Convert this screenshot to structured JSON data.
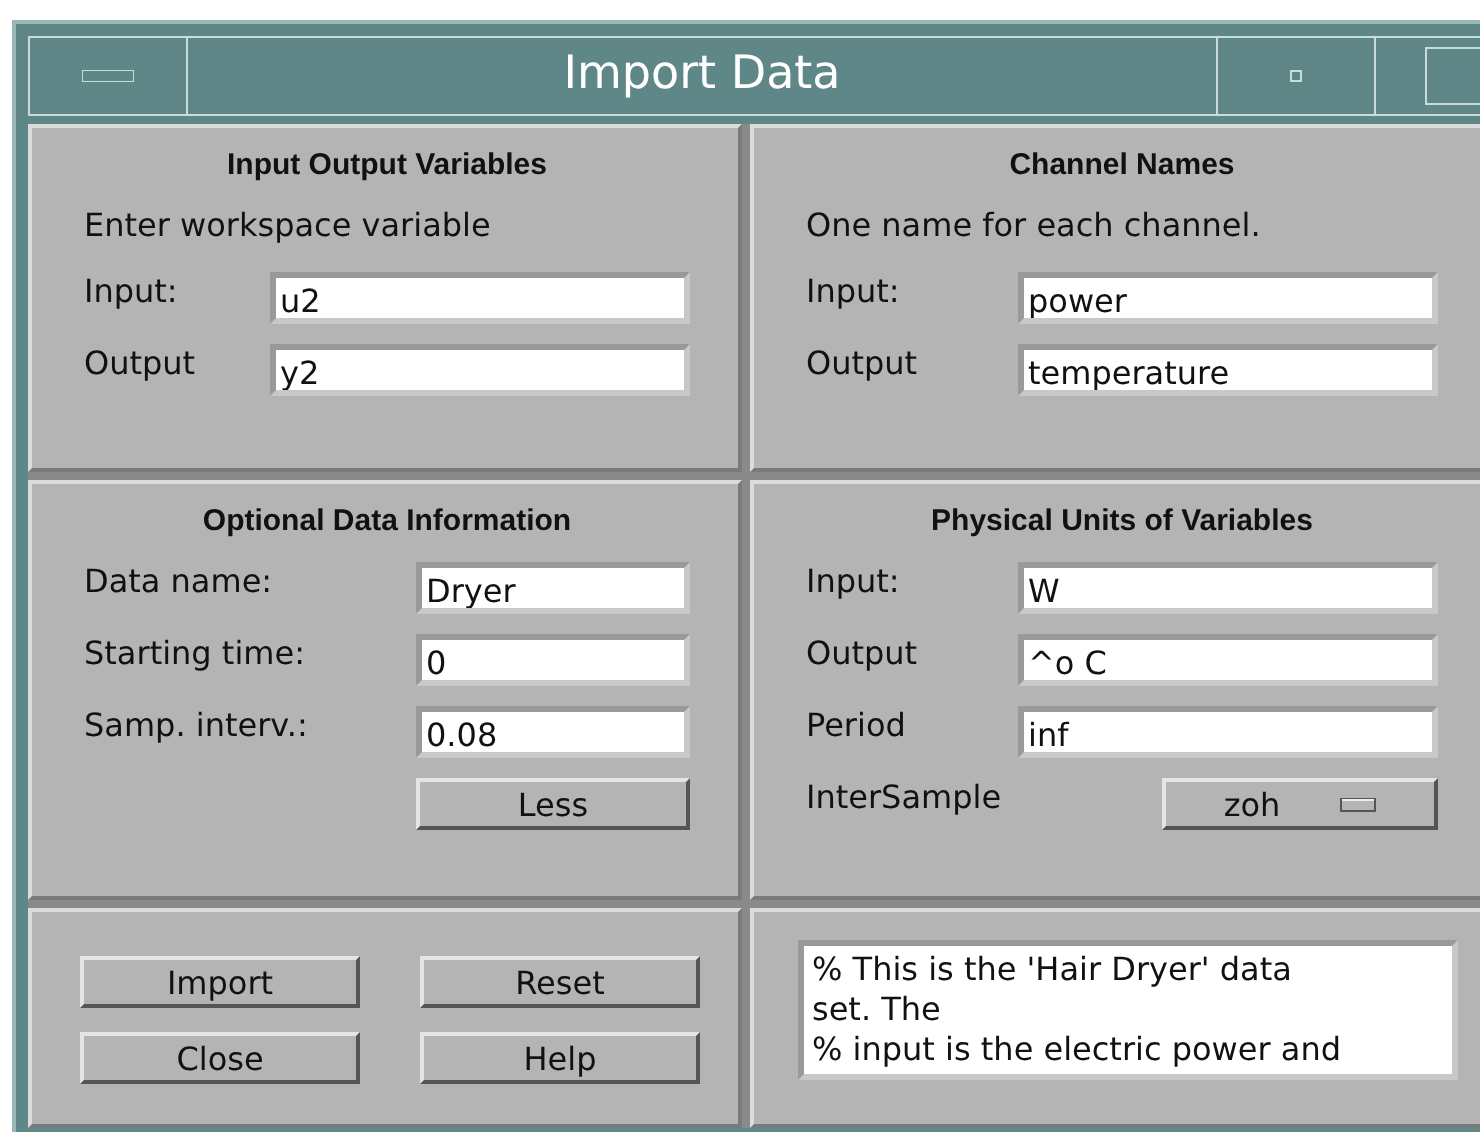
{
  "window": {
    "title": "Import Data"
  },
  "panels": [
    {
      "title": "Input Output Variables",
      "note": "Enter workspace variable",
      "rows": [
        {
          "kind": "field",
          "label": "Input:",
          "value": "u2"
        },
        {
          "kind": "field",
          "label": "Output",
          "value": "y2"
        }
      ]
    },
    {
      "title": "Channel Names",
      "note": "One name for each channel.",
      "rows": [
        {
          "kind": "field",
          "label": "Input:",
          "value": "power"
        },
        {
          "kind": "field",
          "label": "Output",
          "value": "temperature"
        }
      ]
    },
    {
      "title": "Optional Data Information",
      "rows": [
        {
          "kind": "field",
          "label": "Data name:",
          "value": "Dryer"
        },
        {
          "kind": "field",
          "label": "Starting time:",
          "value": "0"
        },
        {
          "kind": "field",
          "label": "Samp. interv.:",
          "value": "0.08"
        },
        {
          "kind": "button",
          "value": "Less"
        }
      ]
    },
    {
      "title": "Physical Units of Variables",
      "rows": [
        {
          "kind": "field",
          "label": "Input:",
          "value": "W"
        },
        {
          "kind": "field",
          "label": "Output",
          "value": "^o C"
        },
        {
          "kind": "field",
          "label": "Period",
          "value": "inf"
        },
        {
          "kind": "menu",
          "label": "InterSample",
          "value": "zoh"
        }
      ]
    }
  ],
  "buttons": [
    "Import",
    "Reset",
    "Close",
    "Help"
  ],
  "notes": [
    "% This is the 'Hair Dryer' data",
    "set. The",
    "% input is the electric power and"
  ]
}
